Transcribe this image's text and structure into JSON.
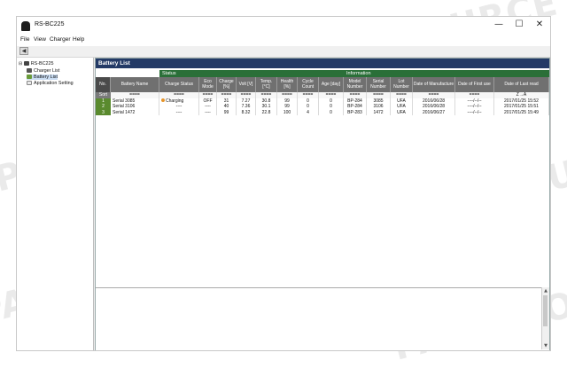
{
  "window": {
    "title": "RS-BC225",
    "controls": {
      "minimize": "—",
      "maximize": "☐",
      "close": "✕"
    }
  },
  "menu": [
    "File",
    "View",
    "Charger",
    "Help"
  ],
  "tree": {
    "root": "RS-BC225",
    "items": [
      "Charger List",
      "Battery List",
      "Application Setting"
    ]
  },
  "panel_title": "Battery List",
  "groups": {
    "status": "Status",
    "information": "Information"
  },
  "columns": {
    "no": "No.",
    "battery_name": "Battery Name",
    "charge_status": "Charge Status",
    "eco_mode": "Eco Mode",
    "charge_pct": "Charge [%]",
    "volt": "Volt [V]",
    "temp": "Temp. [°C]",
    "health": "Health [%]",
    "cycle_count": "Cycle Count",
    "age_day": "Age [day]",
    "model_number": "Model Number",
    "serial_number": "Serial Number",
    "lot_number": "Lot Number",
    "date_manufacture": "Date of Manufacture",
    "date_first_use": "Date of First use",
    "date_last_read": "Date of Last read"
  },
  "sort_row": {
    "label": "Sort",
    "battery_name": "====",
    "charge_status": "====",
    "eco_mode": "====",
    "charge_pct": "====",
    "volt": "====",
    "temp": "====",
    "health": "====",
    "cycle_count": "====",
    "age_day": "====",
    "model_number": "====",
    "serial_number": "====",
    "lot_number": "====",
    "date_manufacture": "====",
    "date_first_use": "====",
    "date_last_read": "Z→A"
  },
  "rows": [
    {
      "no": "1",
      "battery_name": "Serial 3085",
      "charge_status": "Charging",
      "charging": true,
      "eco_mode": "OFF",
      "charge_pct": "31",
      "volt": "7.27",
      "temp": "30.8",
      "health": "99",
      "cycle_count": "0",
      "age_day": "0",
      "model_number": "BP-284",
      "serial_number": "3085",
      "lot_number": "UFA",
      "date_manufacture": "2016/06/28",
      "date_first_use": "----/--/--",
      "date_last_read": "2017/01/25 15:52"
    },
    {
      "no": "2",
      "battery_name": "Serial 3106",
      "charge_status": "----",
      "charging": false,
      "eco_mode": "----",
      "charge_pct": "40",
      "volt": "7.36",
      "temp": "30.1",
      "health": "99",
      "cycle_count": "0",
      "age_day": "0",
      "model_number": "BP-284",
      "serial_number": "3106",
      "lot_number": "UFA",
      "date_manufacture": "2016/06/28",
      "date_first_use": "----/--/--",
      "date_last_read": "2017/01/25 15:51"
    },
    {
      "no": "3",
      "battery_name": "Serial 1472",
      "charge_status": "----",
      "charging": false,
      "eco_mode": "----",
      "charge_pct": "99",
      "volt": "8.32",
      "temp": "22.8",
      "health": "100",
      "cycle_count": "4",
      "age_day": "0",
      "model_number": "BP-283",
      "serial_number": "1472",
      "lot_number": "UFA",
      "date_manufacture": "2016/06/27",
      "date_first_use": "----/--/--",
      "date_last_read": "2017/01/25 15:49"
    }
  ],
  "watermark": "PARTSSOURCE",
  "colors": {
    "header": "#233a66",
    "group": "#2a6f38",
    "rowhdr": "#5a8a2e",
    "charging_dot": "#e6952a"
  }
}
